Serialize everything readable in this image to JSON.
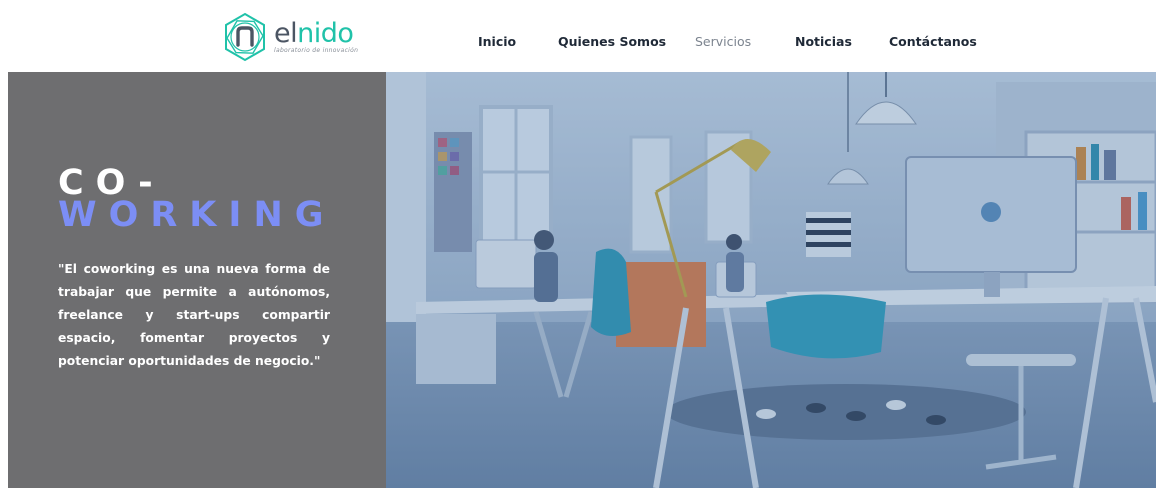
{
  "brand": {
    "name_prefix": "el",
    "name_suffix": "nido",
    "tagline": "laboratorio de innovación",
    "colors": {
      "accent": "#20c2a9",
      "dark": "#4b5563"
    }
  },
  "nav": {
    "items": [
      {
        "label": "Inicio"
      },
      {
        "label": "Quienes Somos"
      },
      {
        "label": "Servicios"
      },
      {
        "label": "Noticias"
      },
      {
        "label": "Contáctanos"
      }
    ]
  },
  "hero": {
    "title_line1": "CO-",
    "title_line2": "WORKING",
    "quote": "\"El coworking es una nueva forma de trabajar que permite a autónomos, freelance y start-ups compartir espacio, fomentar proyectos y potenciar oportunidades de negocio.\"",
    "colors": {
      "panel": "#6e6e70",
      "title_accent": "#7c8ef5",
      "photo_tint": "#3f6f9c"
    }
  }
}
